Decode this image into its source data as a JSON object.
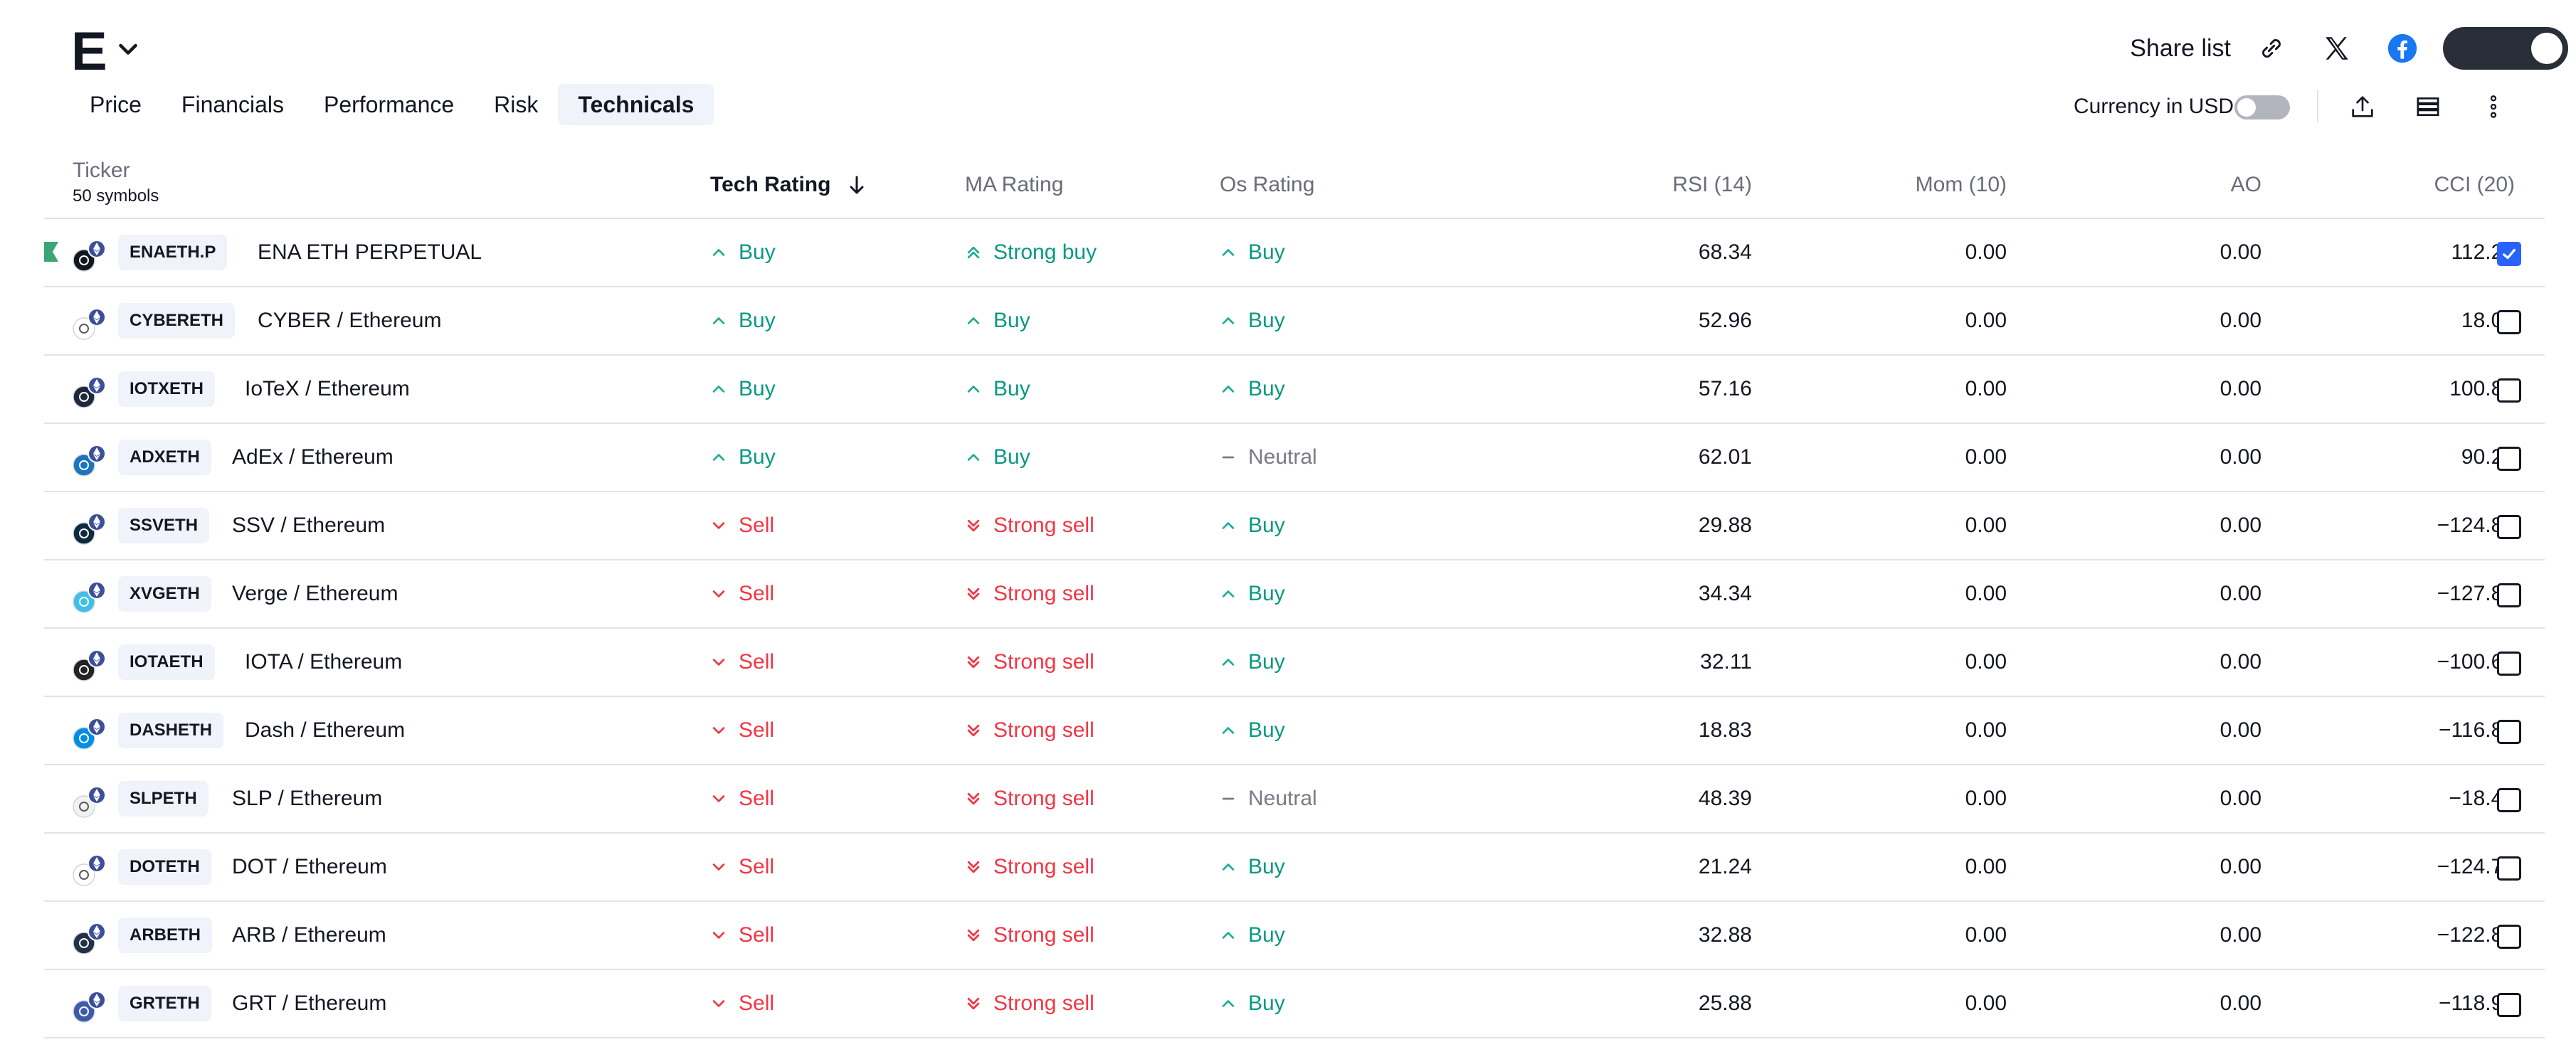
{
  "header": {
    "list_name": "E",
    "share_label": "Share list",
    "icons": [
      "link-icon",
      "x-icon",
      "facebook-icon",
      "dark-mode-toggle"
    ]
  },
  "tabs": [
    {
      "label": "Price",
      "active": false
    },
    {
      "label": "Financials",
      "active": false
    },
    {
      "label": "Performance",
      "active": false
    },
    {
      "label": "Risk",
      "active": false
    },
    {
      "label": "Technicals",
      "active": true
    }
  ],
  "toolbar": {
    "currency_label": "Currency in USD",
    "currency_toggle_on": false,
    "icons": [
      "export-icon",
      "row-density-icon",
      "more-icon"
    ]
  },
  "table": {
    "columns": {
      "ticker": "Ticker",
      "symbols_count": "50 symbols",
      "tech_rating": "Tech Rating",
      "ma_rating": "MA Rating",
      "os_rating": "Os Rating",
      "rsi": "RSI (14)",
      "mom": "Mom (10)",
      "ao": "AO",
      "cci": "CCI (20)"
    },
    "rows": [
      {
        "ticker": "ENAETH.P",
        "name": "ENA ETH PERPETUAL",
        "tech": "Buy",
        "ma": "Strong buy",
        "os": "Buy",
        "rsi": "68.34",
        "mom": "0.00",
        "ao": "0.00",
        "cci": "112.25",
        "checked": true,
        "flagged": true,
        "logo_color": "#131722"
      },
      {
        "ticker": "CYBERETH",
        "name": "CYBER / Ethereum",
        "tech": "Buy",
        "ma": "Buy",
        "os": "Buy",
        "rsi": "52.96",
        "mom": "0.00",
        "ao": "0.00",
        "cci": "18.00",
        "checked": false,
        "flagged": false,
        "logo_color": "#ffffff"
      },
      {
        "ticker": "IOTXETH",
        "name": "IoTeX / Ethereum",
        "tech": "Buy",
        "ma": "Buy",
        "os": "Buy",
        "rsi": "57.16",
        "mom": "0.00",
        "ao": "0.00",
        "cci": "100.89",
        "checked": false,
        "flagged": false,
        "logo_color": "#1e2a3a"
      },
      {
        "ticker": "ADXETH",
        "name": "AdEx / Ethereum",
        "tech": "Buy",
        "ma": "Buy",
        "os": "Neutral",
        "rsi": "62.01",
        "mom": "0.00",
        "ao": "0.00",
        "cci": "90.26",
        "checked": false,
        "flagged": false,
        "logo_color": "#1b75bc"
      },
      {
        "ticker": "SSVETH",
        "name": "SSV / Ethereum",
        "tech": "Sell",
        "ma": "Strong sell",
        "os": "Buy",
        "rsi": "29.88",
        "mom": "0.00",
        "ao": "0.00",
        "cci": "−124.85",
        "checked": false,
        "flagged": false,
        "logo_color": "#0e2a3f"
      },
      {
        "ticker": "XVGETH",
        "name": "Verge / Ethereum",
        "tech": "Sell",
        "ma": "Strong sell",
        "os": "Buy",
        "rsi": "34.34",
        "mom": "0.00",
        "ao": "0.00",
        "cci": "−127.85",
        "checked": false,
        "flagged": false,
        "logo_color": "#40bfe8"
      },
      {
        "ticker": "IOTAETH",
        "name": "IOTA / Ethereum",
        "tech": "Sell",
        "ma": "Strong sell",
        "os": "Buy",
        "rsi": "32.11",
        "mom": "0.00",
        "ao": "0.00",
        "cci": "−100.63",
        "checked": false,
        "flagged": false,
        "logo_color": "#242424"
      },
      {
        "ticker": "DASHETH",
        "name": "Dash / Ethereum",
        "tech": "Sell",
        "ma": "Strong sell",
        "os": "Buy",
        "rsi": "18.83",
        "mom": "0.00",
        "ao": "0.00",
        "cci": "−116.82",
        "checked": false,
        "flagged": false,
        "logo_color": "#008de4"
      },
      {
        "ticker": "SLPETH",
        "name": "SLP / Ethereum",
        "tech": "Sell",
        "ma": "Strong sell",
        "os": "Neutral",
        "rsi": "48.39",
        "mom": "0.00",
        "ao": "0.00",
        "cci": "−18.41",
        "checked": false,
        "flagged": false,
        "logo_color": "#f2f2f2"
      },
      {
        "ticker": "DOTETH",
        "name": "DOT / Ethereum",
        "tech": "Sell",
        "ma": "Strong sell",
        "os": "Buy",
        "rsi": "21.24",
        "mom": "0.00",
        "ao": "0.00",
        "cci": "−124.75",
        "checked": false,
        "flagged": false,
        "logo_color": "#ffffff"
      },
      {
        "ticker": "ARBETH",
        "name": "ARB / Ethereum",
        "tech": "Sell",
        "ma": "Strong sell",
        "os": "Buy",
        "rsi": "32.88",
        "mom": "0.00",
        "ao": "0.00",
        "cci": "−122.86",
        "checked": false,
        "flagged": false,
        "logo_color": "#213147"
      },
      {
        "ticker": "GRTETH",
        "name": "GRT / Ethereum",
        "tech": "Sell",
        "ma": "Strong sell",
        "os": "Buy",
        "rsi": "25.88",
        "mom": "0.00",
        "ao": "0.00",
        "cci": "−118.92",
        "checked": false,
        "flagged": false,
        "logo_color": "#3e5ba9"
      }
    ]
  },
  "colors": {
    "buy": "#22ab94",
    "buy_text": "#089981",
    "sell": "#f23645",
    "sell_text": "#f23645",
    "neutral": "#787b86",
    "accent": "#2962ff",
    "flag": "#3aa675"
  }
}
